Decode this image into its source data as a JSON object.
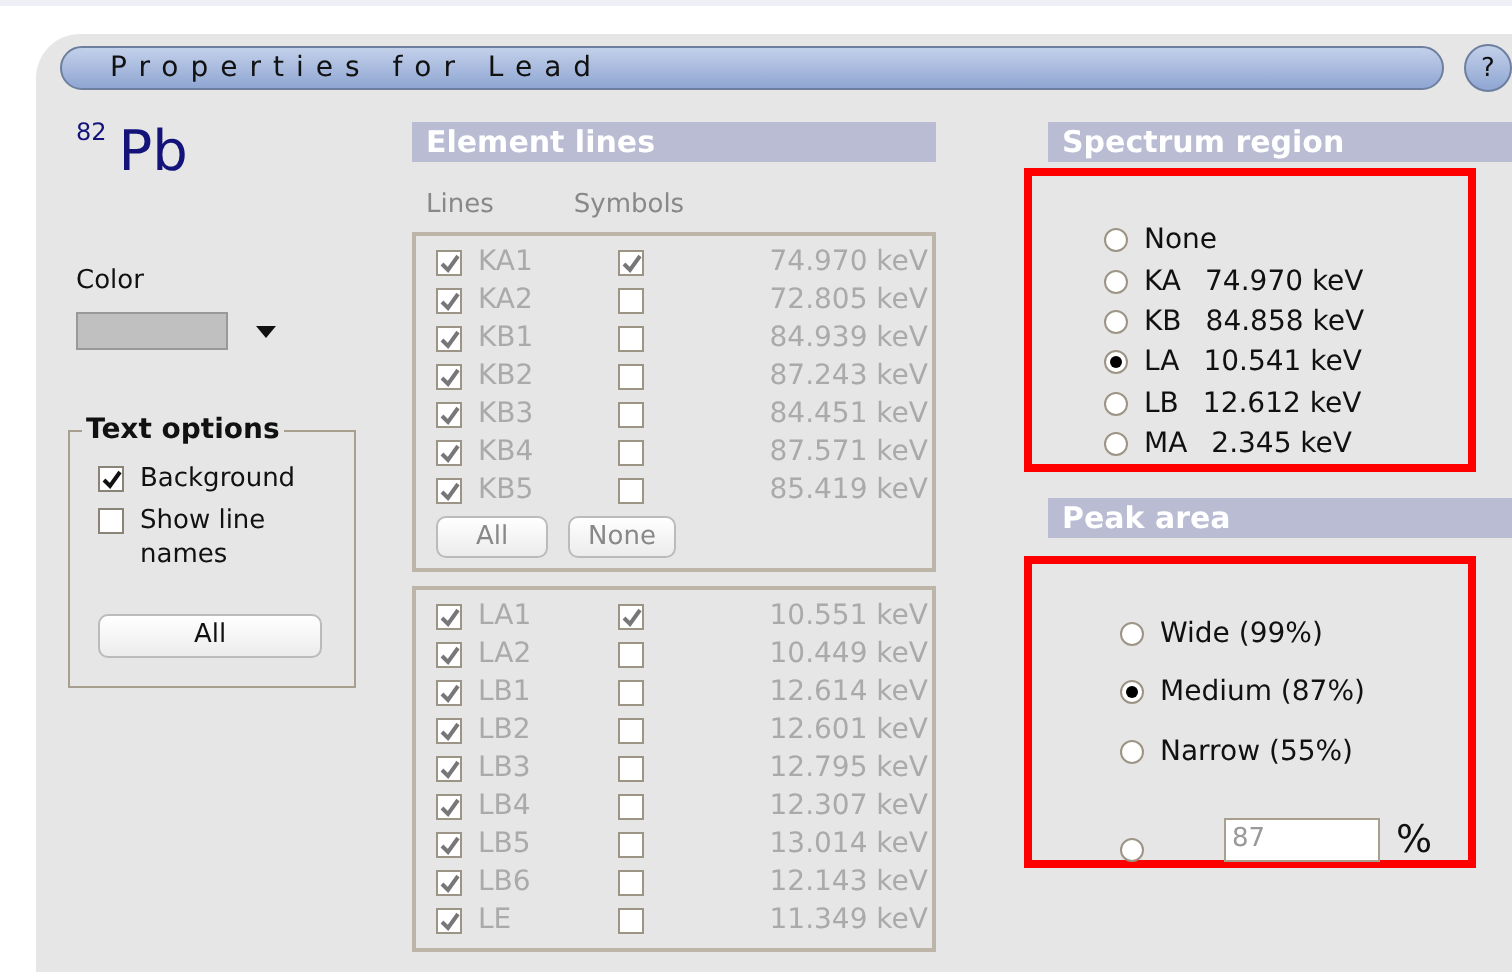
{
  "window": {
    "title": "Properties for Lead",
    "help": "?"
  },
  "element": {
    "atomic_number": "82",
    "symbol": "Pb"
  },
  "color": {
    "label": "Color"
  },
  "text_options": {
    "title": "Text options",
    "options": [
      {
        "label": "Background",
        "checked": true
      },
      {
        "label": "Show line names",
        "checked": false
      }
    ],
    "button": "All"
  },
  "element_lines": {
    "title": "Element lines",
    "disabled": true,
    "columns": [
      "Lines",
      "Symbols"
    ],
    "groups": [
      {
        "rows": [
          {
            "name": "KA1",
            "line": true,
            "symbol": true,
            "energy": "74.970 keV"
          },
          {
            "name": "KA2",
            "line": true,
            "symbol": false,
            "energy": "72.805 keV"
          },
          {
            "name": "KB1",
            "line": true,
            "symbol": false,
            "energy": "84.939 keV"
          },
          {
            "name": "KB2",
            "line": true,
            "symbol": false,
            "energy": "87.243 keV"
          },
          {
            "name": "KB3",
            "line": true,
            "symbol": false,
            "energy": "84.451 keV"
          },
          {
            "name": "KB4",
            "line": true,
            "symbol": false,
            "energy": "87.571 keV"
          },
          {
            "name": "KB5",
            "line": true,
            "symbol": false,
            "energy": "85.419 keV"
          }
        ],
        "buttons": [
          "All",
          "None"
        ]
      },
      {
        "rows": [
          {
            "name": "LA1",
            "line": true,
            "symbol": true,
            "energy": "10.551 keV"
          },
          {
            "name": "LA2",
            "line": true,
            "symbol": false,
            "energy": "10.449 keV"
          },
          {
            "name": "LB1",
            "line": true,
            "symbol": false,
            "energy": "12.614 keV"
          },
          {
            "name": "LB2",
            "line": true,
            "symbol": false,
            "energy": "12.601 keV"
          },
          {
            "name": "LB3",
            "line": true,
            "symbol": false,
            "energy": "12.795 keV"
          },
          {
            "name": "LB4",
            "line": true,
            "symbol": false,
            "energy": "12.307 keV"
          },
          {
            "name": "LB5",
            "line": true,
            "symbol": false,
            "energy": "13.014 keV"
          },
          {
            "name": "LB6",
            "line": true,
            "symbol": false,
            "energy": "12.143 keV"
          },
          {
            "name": "LE",
            "line": true,
            "symbol": false,
            "energy": "11.349 keV"
          }
        ]
      }
    ]
  },
  "spectrum_region": {
    "title": "Spectrum region",
    "options": [
      {
        "label": "None",
        "selected": false
      },
      {
        "label": "KA",
        "energy": "74.970 keV",
        "selected": false
      },
      {
        "label": "KB",
        "energy": "84.858 keV",
        "selected": false
      },
      {
        "label": "LA",
        "energy": "10.541 keV",
        "selected": true
      },
      {
        "label": "LB",
        "energy": "12.612 keV",
        "selected": false
      },
      {
        "label": "MA",
        "energy": "2.345 keV",
        "selected": false
      }
    ]
  },
  "peak_area": {
    "title": "Peak area",
    "options": [
      {
        "kind": "preset",
        "label": "Wide (99%)",
        "selected": false
      },
      {
        "kind": "preset",
        "label": "Medium (87%)",
        "selected": true
      },
      {
        "kind": "preset",
        "label": "Narrow (55%)",
        "selected": false
      },
      {
        "kind": "custom",
        "value": "87",
        "unit": "%",
        "selected": false
      }
    ]
  }
}
